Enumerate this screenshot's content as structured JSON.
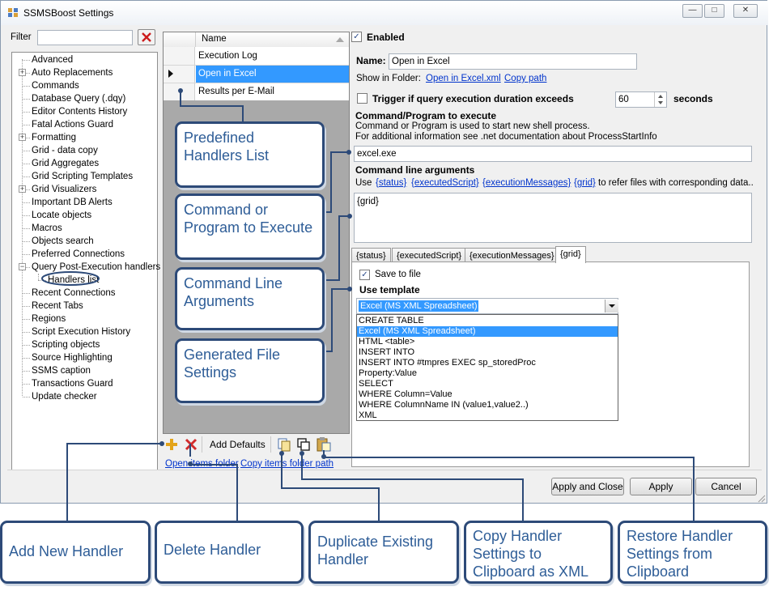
{
  "window": {
    "title": "SSMSBoost Settings"
  },
  "filter": {
    "label": "Filter",
    "value": ""
  },
  "tree": {
    "items": [
      "Advanced",
      "Auto Replacements",
      "Commands",
      "Database Query (.dqy)",
      "Editor Contents History",
      "Fatal Actions Guard",
      "Formatting",
      "Grid - data copy",
      "Grid Aggregates",
      "Grid Scripting Templates",
      "Grid Visualizers",
      "Important DB Alerts",
      "Locate objects",
      "Macros",
      "Objects search",
      "Preferred Connections",
      "Query Post-Execution handlers",
      "Handlers list",
      "Recent Connections",
      "Recent Tabs",
      "Regions",
      "Script Execution History",
      "Scripting objects",
      "Source Highlighting",
      "SSMS caption",
      "Transactions Guard",
      "Update checker"
    ]
  },
  "grid": {
    "column": "Name",
    "rows": [
      "Execution Log",
      "Open in Excel",
      "Results per E-Mail"
    ]
  },
  "details": {
    "enabled_label": "Enabled",
    "name_label": "Name:",
    "name_value": "Open in Excel",
    "show_in_folder_label": "Show in Folder:",
    "show_in_folder_link": "Open in Excel.xml",
    "copy_path_link": "Copy path",
    "trigger_label": "Trigger if query execution duration exceeds",
    "trigger_value": "60",
    "seconds_label": "seconds",
    "command_heading": "Command/Program to execute",
    "command_desc1": "Command or Program is used to start new shell process.",
    "command_desc2": "For additional information see .net documentation about ProcessStartInfo",
    "command_value": "excel.exe",
    "args_heading": "Command line arguments",
    "args_use": "Use",
    "args_tokens": [
      "{status}",
      "{executedScript}",
      "{executionMessages}",
      "{grid}"
    ],
    "args_suffix": "to refer files with corresponding data..",
    "args_value": "{grid}",
    "tabs": [
      "{status}",
      "{executedScript}",
      "{executionMessages}",
      "{grid}"
    ],
    "save_to_file_label": "Save to file",
    "use_template_label": "Use template",
    "template_selected": "Excel (MS XML Spreadsheet)",
    "template_options": [
      "CREATE TABLE",
      "Excel (MS XML Spreadsheet)",
      "HTML <table>",
      "INSERT INTO",
      "INSERT INTO #tmpres EXEC sp_storedProc",
      "Property:Value",
      "SELECT",
      "WHERE Column=Value",
      "WHERE ColumnName IN (value1,value2..)",
      "XML"
    ]
  },
  "toolbar": {
    "add_defaults": "Add Defaults",
    "open_items_folder": "Open items folder",
    "copy_items_folder_path": "Copy items folder path"
  },
  "footer": {
    "apply_close": "Apply and Close",
    "apply": "Apply",
    "cancel": "Cancel"
  },
  "callouts": {
    "predefined": "Predefined Handlers List",
    "command": "Command or Program to Execute",
    "cmdargs": "Command Line Arguments",
    "generated": "Generated File Settings",
    "add": "Add New Handler",
    "delete": "Delete Handler",
    "duplicate": "Duplicate Existing Handler",
    "copy": "Copy Handler Settings to Clipboard as XML",
    "restore": "Restore Handler Settings from Clipboard"
  },
  "colors": {
    "accent": "#2d4a78",
    "callout_text": "#2e5d97",
    "selection": "#3399ff",
    "link": "#0033cc"
  }
}
